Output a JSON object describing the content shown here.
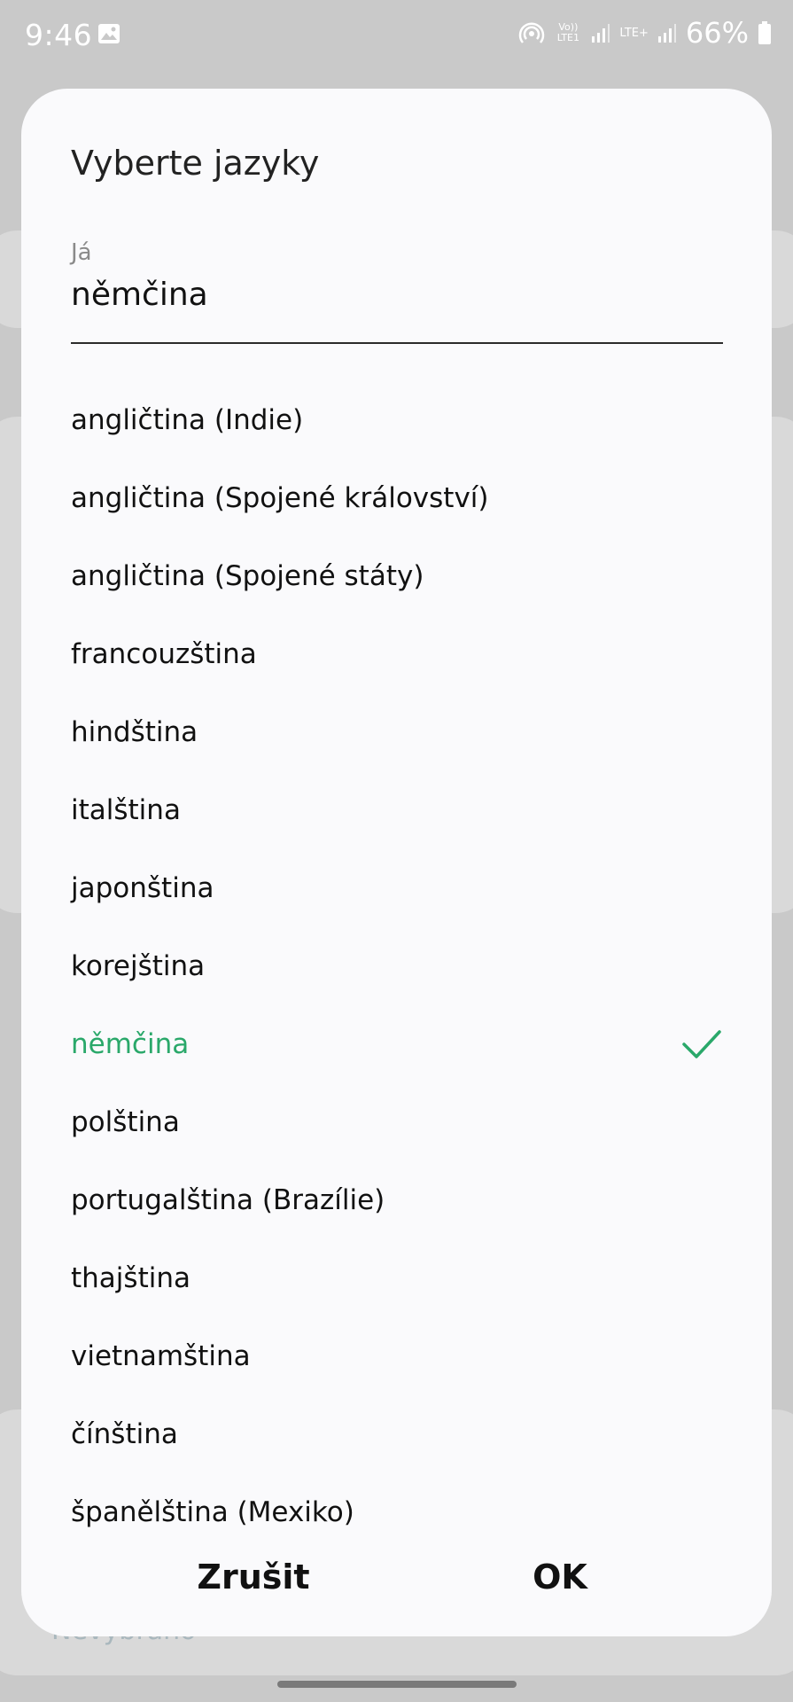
{
  "status_bar": {
    "time": "9:46",
    "net1": "Vo)) LTE1",
    "net2": "LTE+",
    "battery": "66%",
    "icons": [
      "image-icon",
      "hotspot-icon",
      "signal-icon",
      "signal-icon",
      "battery-icon"
    ]
  },
  "background": {
    "hint_text": "Nevybráno"
  },
  "dialog": {
    "title": "Vyberte jazyky",
    "field_label": "Já",
    "field_value": "němčina",
    "languages": [
      {
        "label": "angličtina (Indie)"
      },
      {
        "label": "angličtina (Spojené království)"
      },
      {
        "label": "angličtina (Spojené státy)"
      },
      {
        "label": "francouzština"
      },
      {
        "label": "hindština"
      },
      {
        "label": "italština"
      },
      {
        "label": "japonština"
      },
      {
        "label": "korejština"
      },
      {
        "label": "němčina"
      },
      {
        "label": "polština"
      },
      {
        "label": "portugalština (Brazílie)"
      },
      {
        "label": "thajština"
      },
      {
        "label": "vietnamština"
      },
      {
        "label": "čínština"
      },
      {
        "label": "španělština (Mexiko)"
      }
    ],
    "selected_language": "němčina",
    "cancel_label": "Zrušit",
    "ok_label": "OK"
  },
  "colors": {
    "accent": "#2aa86a",
    "dialog_bg": "#fafafc",
    "scrim": "#c9c9c9"
  }
}
